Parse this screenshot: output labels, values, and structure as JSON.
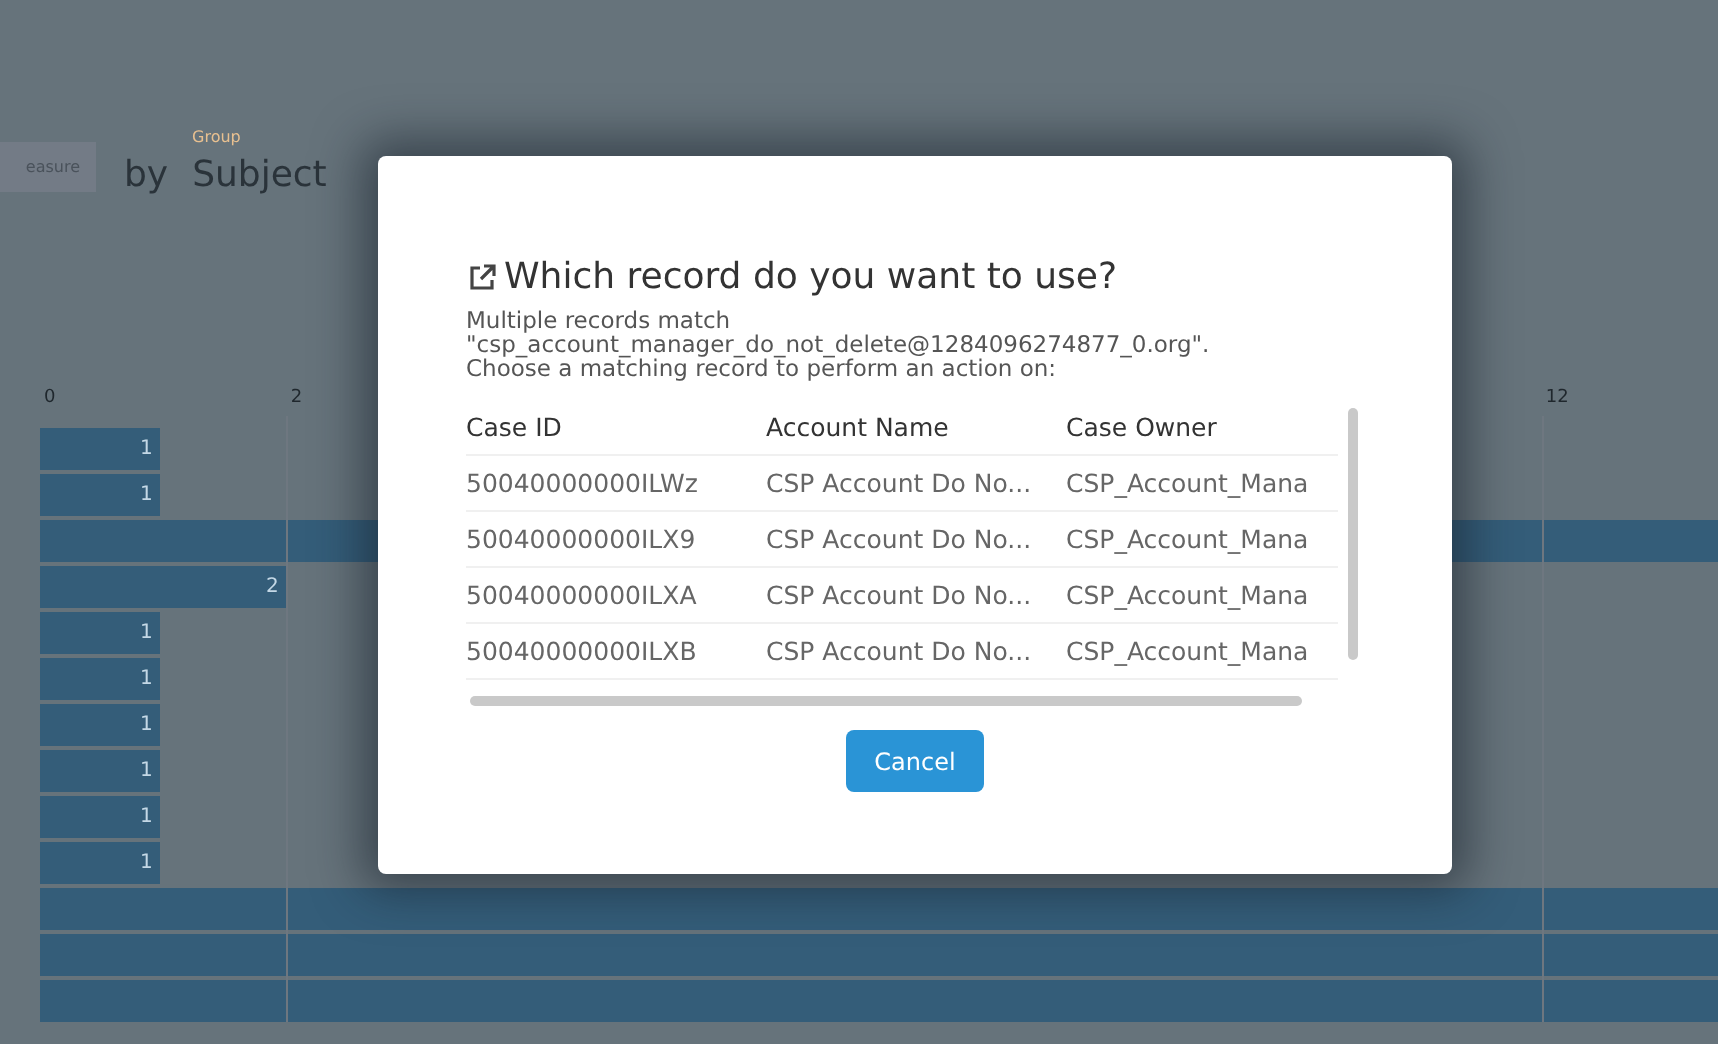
{
  "backdrop": {
    "measure_button": "easure",
    "group_label": "Group",
    "by": "by",
    "group_value": "Subject",
    "axis_ticks": [
      {
        "label": "0",
        "level": 0
      },
      {
        "label": "2",
        "level": 0.147
      },
      {
        "label": "12",
        "level": 0.895
      }
    ],
    "bars": [
      {
        "label": "1",
        "level": 0.072
      },
      {
        "label": "1",
        "level": 0.072
      },
      {
        "level": 1
      },
      {
        "label": "2",
        "level": 0.147
      },
      {
        "label": "1",
        "level": 0.072
      },
      {
        "label": "1",
        "level": 0.072
      },
      {
        "label": "1",
        "level": 0.072
      },
      {
        "label": "1",
        "level": 0.072
      },
      {
        "label": "1",
        "level": 0.072
      },
      {
        "label": "1",
        "level": 0.072
      },
      {
        "level": 1
      },
      {
        "level": 1
      },
      {
        "level": 1
      }
    ]
  },
  "dialog": {
    "title": "Which record do you want to use?",
    "message": [
      "Multiple records match",
      "\"csp_account_manager_do_not_delete@1284096274877_0.org\".",
      "Choose a matching record to perform an action on:"
    ],
    "table": {
      "columns": [
        "Case ID",
        "Account Name",
        "Case Owner"
      ],
      "rows": [
        [
          "50040000000ILWz",
          "CSP Account Do No...",
          "CSP_Account_Mana"
        ],
        [
          "50040000000ILX9",
          "CSP Account Do No...",
          "CSP_Account_Mana"
        ],
        [
          "50040000000ILXA",
          "CSP Account Do No...",
          "CSP_Account_Mana"
        ],
        [
          "50040000000ILXB",
          "CSP Account Do No...",
          "CSP_Account_Mana"
        ]
      ]
    },
    "buttons": [
      "Cancel"
    ]
  }
}
